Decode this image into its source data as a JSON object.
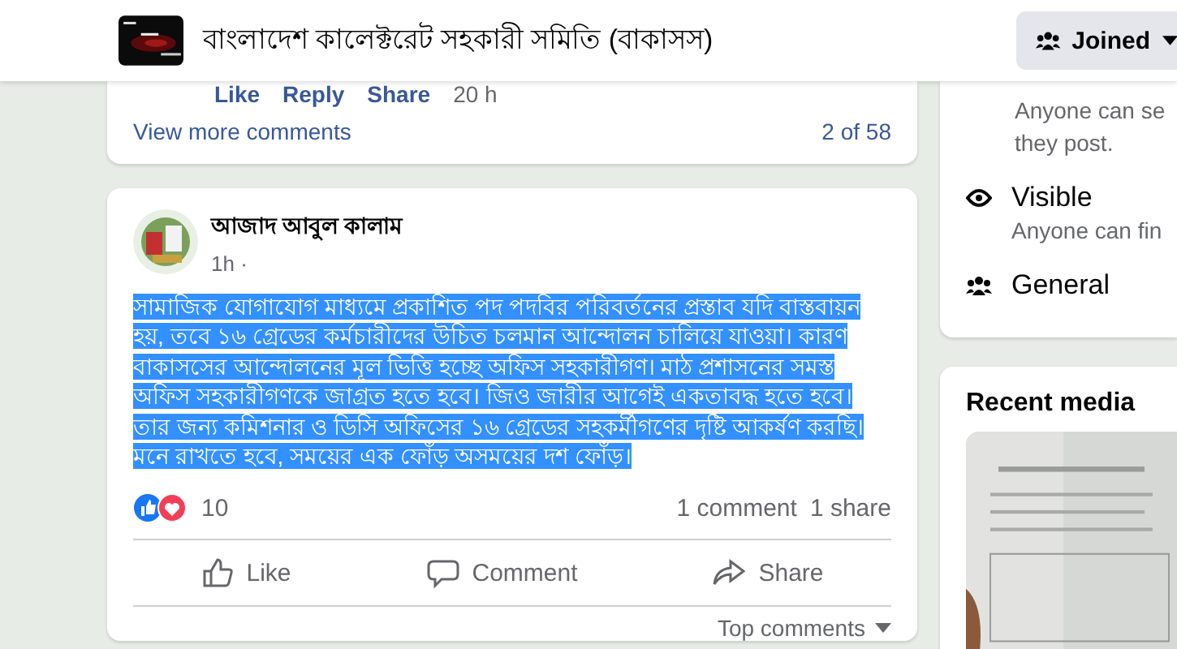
{
  "header": {
    "group_name": "বাংলাদেশ কালেক্টরেট সহকারী সমিতি (বাকাসস)",
    "join_button": "Joined"
  },
  "previous_post": {
    "comment_actions": [
      "Like",
      "Reply",
      "Share"
    ],
    "comment_time": "20 h",
    "more_comments": "View more comments",
    "comment_count": "2 of 58"
  },
  "post": {
    "author": "আজাদ আবুল কালাম",
    "time": "1h ·",
    "body_selected": true,
    "body": "সামাজিক যোগাযোগ মাধ্যমে প্রকাশিত পদ পদবির পরিবর্তনের প্রস্তাব যদি বাস্তবায়ন হয়, তবে ১৬ গ্রেডের কর্মচারীদের উচিত চলমান আন্দোলন চালিয়ে যাওয়া। কারণ বাকাসসের আন্দোলনের মূল ভিত্তি হচ্ছে অফিস সহকারীগণ। মাঠ প্রশাসনের সমস্ত অফিস সহকারীগণকে জাগ্রত হতে হবে। জিও জারীর আগেই একতাবদ্ধ হতে হবে। তার জন্য কমিশনার ও ডিসি অফিসের ১৬ গ্রেডের সহকর্মীগণের দৃষ্টি আকর্ষণ করছি। মনে রাখতে হবে, সময়ের এক ফোঁড় অসময়ের দশ ফোঁড়।",
    "reaction_count": "10",
    "comments": "1 comment",
    "shares": "1 share",
    "actions": [
      {
        "kind": "like",
        "label": "Like"
      },
      {
        "kind": "comment",
        "label": "Comment"
      },
      {
        "kind": "share",
        "label": "Share"
      }
    ],
    "sort": "Top comments"
  },
  "about": {
    "privacy_lines": [
      "Anyone can se",
      "they post."
    ],
    "items": [
      {
        "kind": "visible",
        "title": "Visible",
        "text": "Anyone can fin"
      },
      {
        "kind": "general",
        "title": "General"
      }
    ]
  },
  "recent_media": {
    "title": "Recent media"
  }
}
